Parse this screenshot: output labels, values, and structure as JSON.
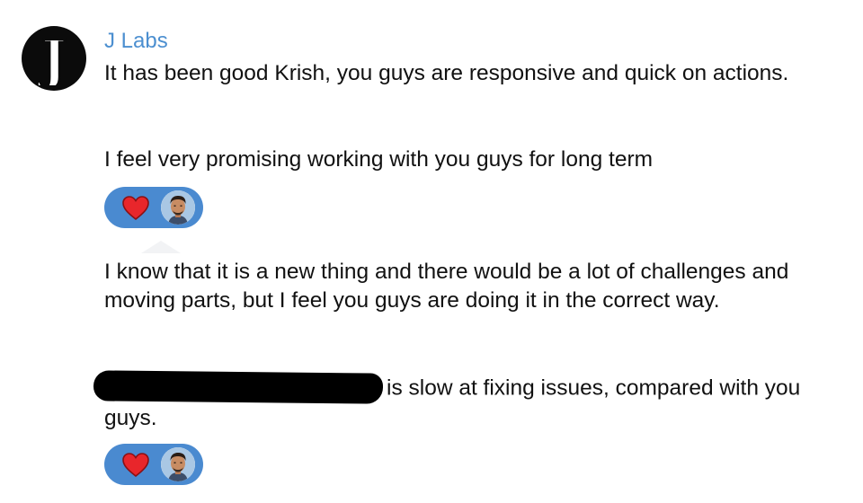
{
  "message": {
    "sender": "J Labs",
    "avatar_letter": "J",
    "paragraphs": [
      "It has been good Krish, you guys are responsive and quick on actions.",
      "I feel very promising working with you guys for long term",
      "I know that it is a new thing and there would be a lot of challenges and moving parts, but I feel you guys are doing it in the correct way.",
      "is slow at fixing issues, compared with you guys."
    ],
    "reactions": [
      {
        "icon": "heart-icon",
        "user": "reactor-avatar"
      },
      {
        "icon": "heart-icon",
        "user": "reactor-avatar"
      }
    ]
  },
  "colors": {
    "sender_name": "#4c8fd0",
    "reaction_pill": "#4a8ad0",
    "heart": "#e8262b",
    "text": "#111111"
  }
}
